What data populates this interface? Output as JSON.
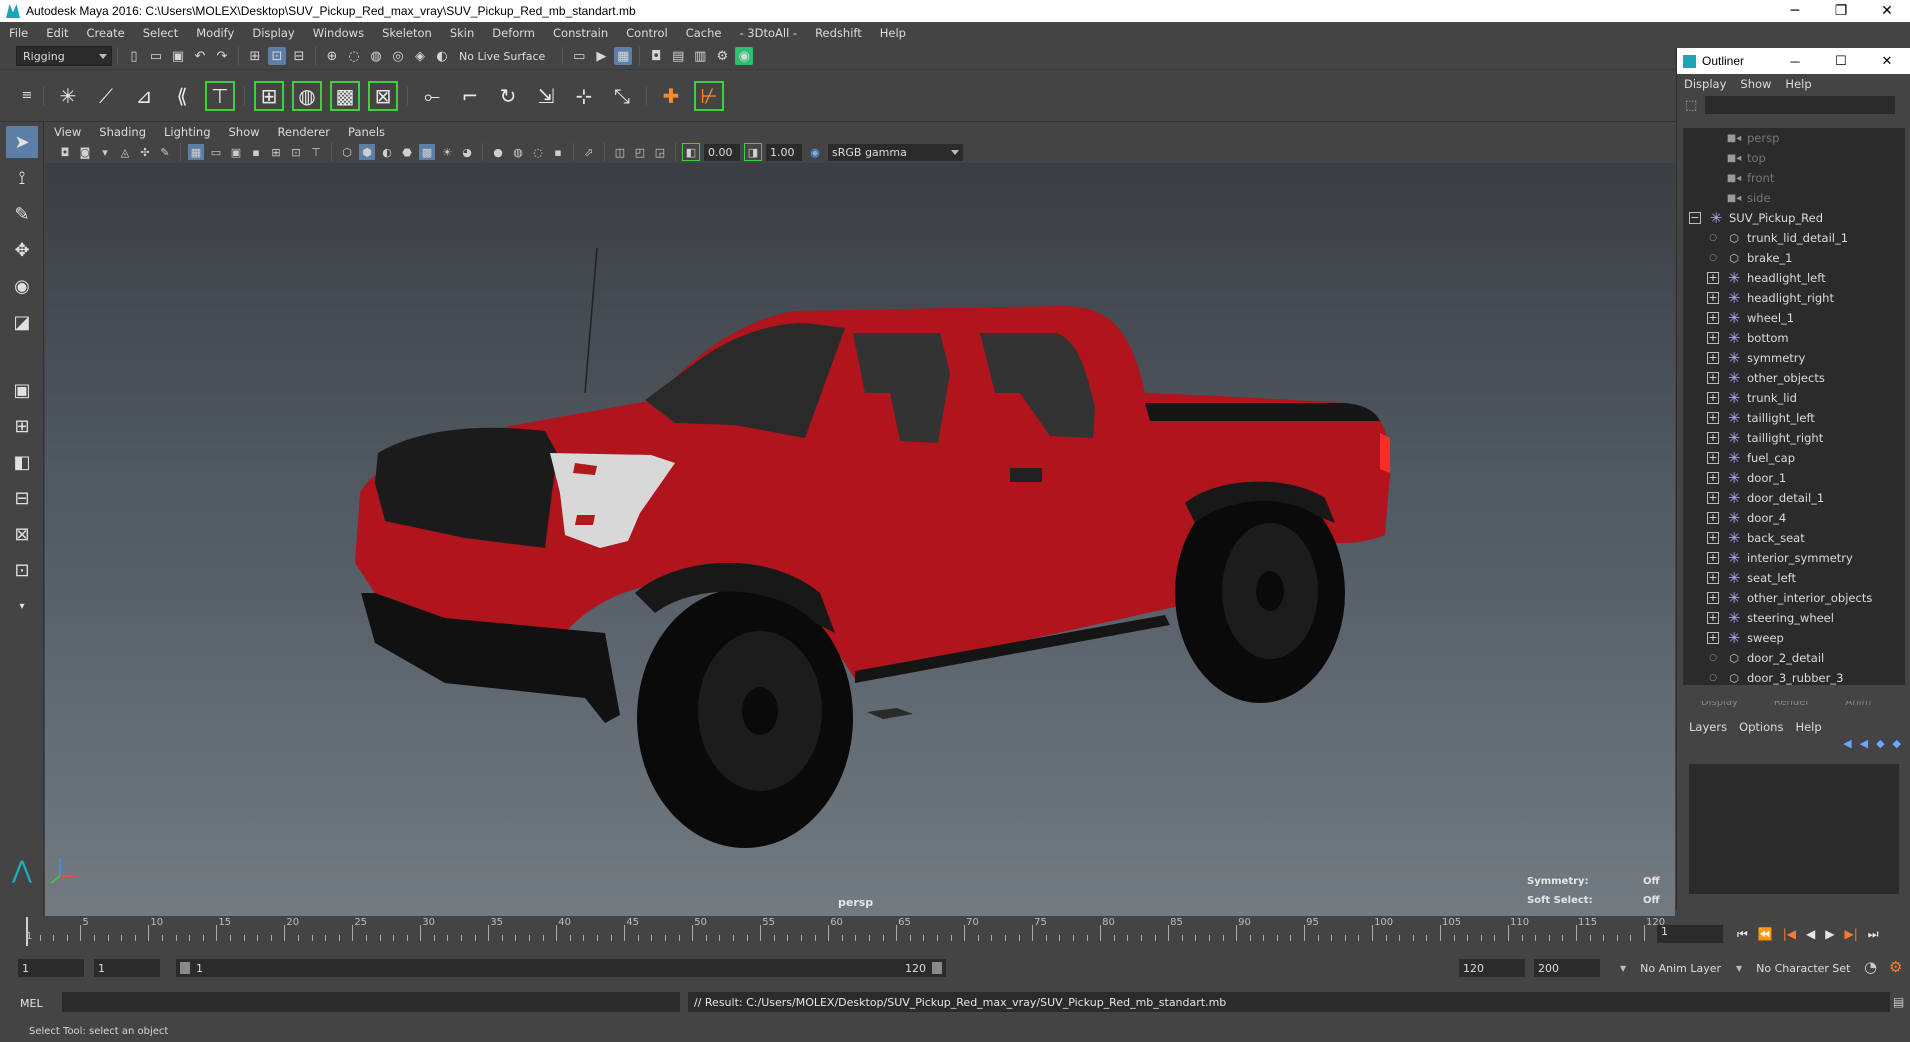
{
  "window": {
    "title": "Autodesk Maya 2016: C:\\Users\\MOLEX\\Desktop\\SUV_Pickup_Red_max_vray\\SUV_Pickup_Red_mb_standart.mb",
    "minimize": "─",
    "restore": "❐",
    "close": "✕"
  },
  "menubar": [
    "File",
    "Edit",
    "Create",
    "Select",
    "Modify",
    "Display",
    "Windows",
    "Skeleton",
    "Skin",
    "Deform",
    "Constrain",
    "Control",
    "Cache",
    "- 3DtoAll -",
    "Redshift",
    "Help"
  ],
  "statusline": {
    "menuset": "Rigging",
    "live_surface": "No Live Surface"
  },
  "viewport": {
    "menu": [
      "View",
      "Shading",
      "Lighting",
      "Show",
      "Renderer",
      "Panels"
    ],
    "exposure": "0.00",
    "gamma": "1.00",
    "color_space": "sRGB gamma",
    "camera_label": "persp",
    "symmetry_label": "Symmetry:",
    "symmetry_value": "Off",
    "soft_select_label": "Soft Select:",
    "soft_select_value": "Off",
    "model_color": "#b0141c"
  },
  "outliner": {
    "title": "Outliner",
    "menu": [
      "Display",
      "Show",
      "Help"
    ],
    "items": [
      {
        "label": "persp",
        "type": "camera",
        "dim": true,
        "expander": "none",
        "indent": 1
      },
      {
        "label": "top",
        "type": "camera",
        "dim": true,
        "expander": "none",
        "indent": 1
      },
      {
        "label": "front",
        "type": "camera",
        "dim": true,
        "expander": "none",
        "indent": 1
      },
      {
        "label": "side",
        "type": "camera",
        "dim": true,
        "expander": "none",
        "indent": 1
      },
      {
        "label": "SUV_Pickup_Red",
        "type": "group",
        "dim": false,
        "expander": "minus",
        "indent": 0
      },
      {
        "label": "trunk_lid_detail_1",
        "type": "mesh",
        "dim": false,
        "expander": "dot",
        "indent": 1
      },
      {
        "label": "brake_1",
        "type": "mesh",
        "dim": false,
        "expander": "dot",
        "indent": 1
      },
      {
        "label": "headlight_left",
        "type": "group",
        "dim": false,
        "expander": "plus",
        "indent": 1
      },
      {
        "label": "headlight_right",
        "type": "group",
        "dim": false,
        "expander": "plus",
        "indent": 1
      },
      {
        "label": "wheel_1",
        "type": "group",
        "dim": false,
        "expander": "plus",
        "indent": 1
      },
      {
        "label": "bottom",
        "type": "group",
        "dim": false,
        "expander": "plus",
        "indent": 1
      },
      {
        "label": "symmetry",
        "type": "group",
        "dim": false,
        "expander": "plus",
        "indent": 1
      },
      {
        "label": "other_objects",
        "type": "group",
        "dim": false,
        "expander": "plus",
        "indent": 1
      },
      {
        "label": "trunk_lid",
        "type": "group",
        "dim": false,
        "expander": "plus",
        "indent": 1
      },
      {
        "label": "taillight_left",
        "type": "group",
        "dim": false,
        "expander": "plus",
        "indent": 1
      },
      {
        "label": "taillight_right",
        "type": "group",
        "dim": false,
        "expander": "plus",
        "indent": 1
      },
      {
        "label": "fuel_cap",
        "type": "group",
        "dim": false,
        "expander": "plus",
        "indent": 1
      },
      {
        "label": "door_1",
        "type": "group",
        "dim": false,
        "expander": "plus",
        "indent": 1
      },
      {
        "label": "door_detail_1",
        "type": "group",
        "dim": false,
        "expander": "plus",
        "indent": 1
      },
      {
        "label": "door_4",
        "type": "group",
        "dim": false,
        "expander": "plus",
        "indent": 1
      },
      {
        "label": "back_seat",
        "type": "group",
        "dim": false,
        "expander": "plus",
        "indent": 1
      },
      {
        "label": "interior_symmetry",
        "type": "group",
        "dim": false,
        "expander": "plus",
        "indent": 1
      },
      {
        "label": "seat_left",
        "type": "group",
        "dim": false,
        "expander": "plus",
        "indent": 1
      },
      {
        "label": "other_interior_objects",
        "type": "group",
        "dim": false,
        "expander": "plus",
        "indent": 1
      },
      {
        "label": "steering_wheel",
        "type": "group",
        "dim": false,
        "expander": "plus",
        "indent": 1
      },
      {
        "label": "sweep",
        "type": "group",
        "dim": false,
        "expander": "plus",
        "indent": 1
      },
      {
        "label": "door_2_detail",
        "type": "mesh",
        "dim": false,
        "expander": "dot",
        "indent": 1
      },
      {
        "label": "door_3_rubber_3",
        "type": "mesh",
        "dim": false,
        "expander": "dot",
        "indent": 1
      }
    ]
  },
  "layers": {
    "tabs": [
      "Display",
      "Render",
      "Anim"
    ],
    "menu": [
      "Layers",
      "Options",
      "Help"
    ]
  },
  "timeline": {
    "start_label": "1",
    "ticks": [
      "5",
      "10",
      "15",
      "20",
      "25",
      "30",
      "35",
      "40",
      "45",
      "50",
      "55",
      "60",
      "65",
      "70",
      "75",
      "80",
      "85",
      "90",
      "95",
      "100",
      "105",
      "110",
      "115",
      "120"
    ],
    "current_frame": "1"
  },
  "range": {
    "start": "1",
    "playback_start": "1",
    "range_start_label": "1",
    "range_end_label": "120",
    "playback_end": "120",
    "end": "200",
    "anim_layer": "No Anim Layer",
    "character_set": "No Character Set"
  },
  "cmdline": {
    "mode": "MEL",
    "result": "// Result: C:/Users/MOLEX/Desktop/SUV_Pickup_Red_max_vray/SUV_Pickup_Red_mb_standart.mb"
  },
  "helpline": "Select Tool: select an object"
}
